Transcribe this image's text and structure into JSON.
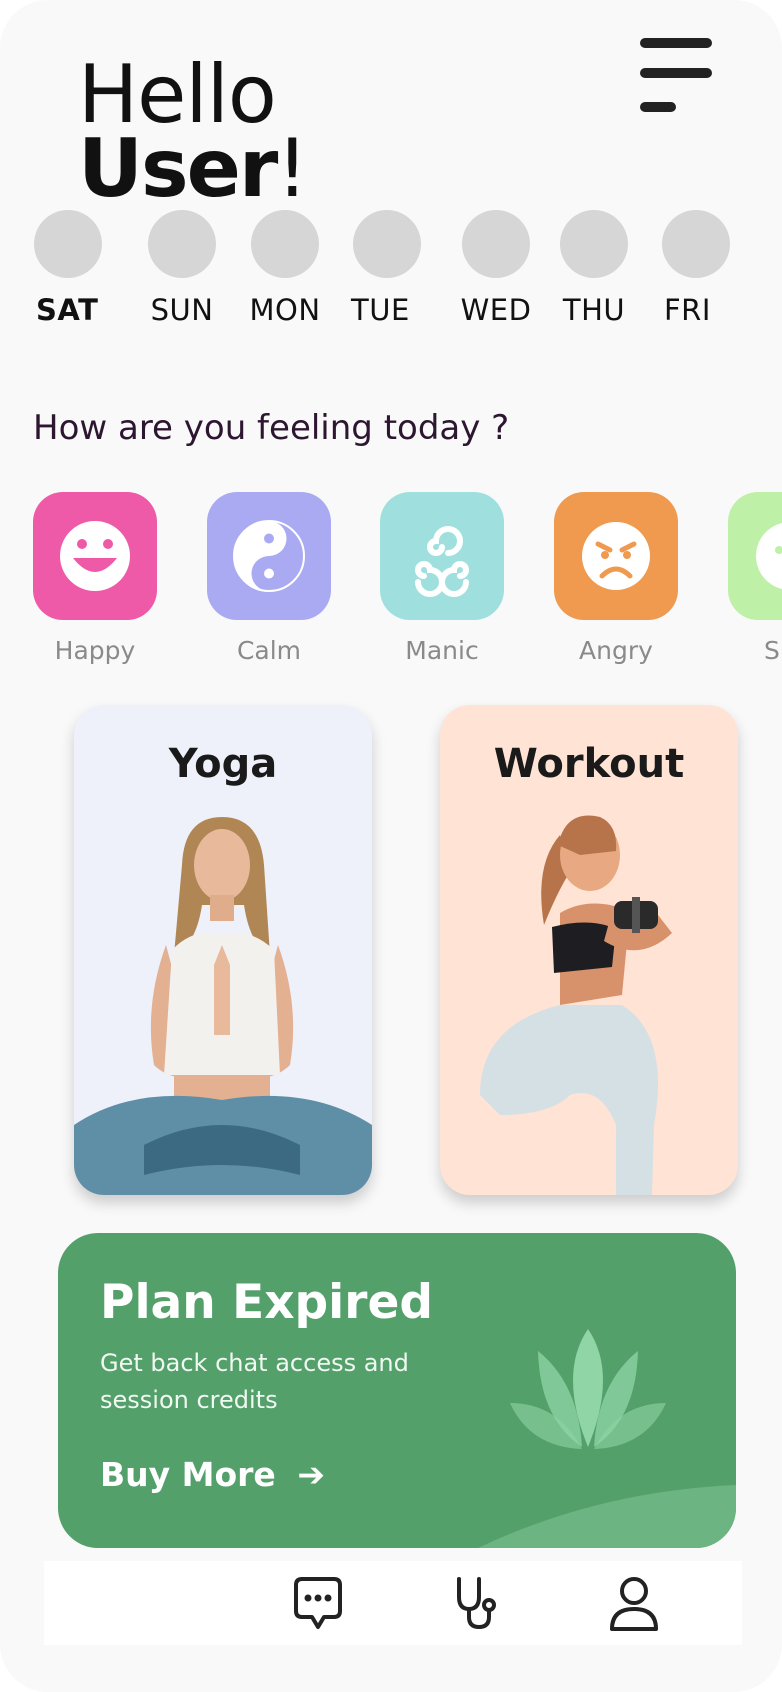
{
  "header": {
    "hello": "Hello",
    "user": "User",
    "exclaim": "!"
  },
  "week": [
    {
      "label": "SAT",
      "active": true
    },
    {
      "label": "SUN",
      "active": false
    },
    {
      "label": "MON",
      "active": false
    },
    {
      "label": "TUE",
      "active": false
    },
    {
      "label": "WED",
      "active": false
    },
    {
      "label": "THU",
      "active": false
    },
    {
      "label": "FRI",
      "active": false
    }
  ],
  "mood_prompt": "How are you feeling today ?",
  "moods": [
    {
      "label": "Happy",
      "color": "#ee5aa8",
      "icon": "happy-face-icon"
    },
    {
      "label": "Calm",
      "color": "#aaaaf2",
      "icon": "yin-yang-icon"
    },
    {
      "label": "Manic",
      "color": "#9fe0df",
      "icon": "triple-spiral-icon"
    },
    {
      "label": "Angry",
      "color": "#ef9a4e",
      "icon": "angry-face-icon"
    },
    {
      "label": "S",
      "color": "#bff0a8",
      "icon": "sad-face-icon"
    }
  ],
  "activities": [
    {
      "title": "Yoga",
      "bg": "#eef0fa"
    },
    {
      "title": "Workout",
      "bg": "#ffe3d5"
    }
  ],
  "plan": {
    "title": "Plan Expired",
    "description": "Get back chat access and session credits",
    "cta": "Buy More",
    "cta_icon": "arrow-right-icon",
    "bg": "#54a06b",
    "icon": "lotus-icon"
  },
  "nav": [
    {
      "icon": "chat-icon"
    },
    {
      "icon": "stethoscope-icon"
    },
    {
      "icon": "profile-icon"
    }
  ]
}
